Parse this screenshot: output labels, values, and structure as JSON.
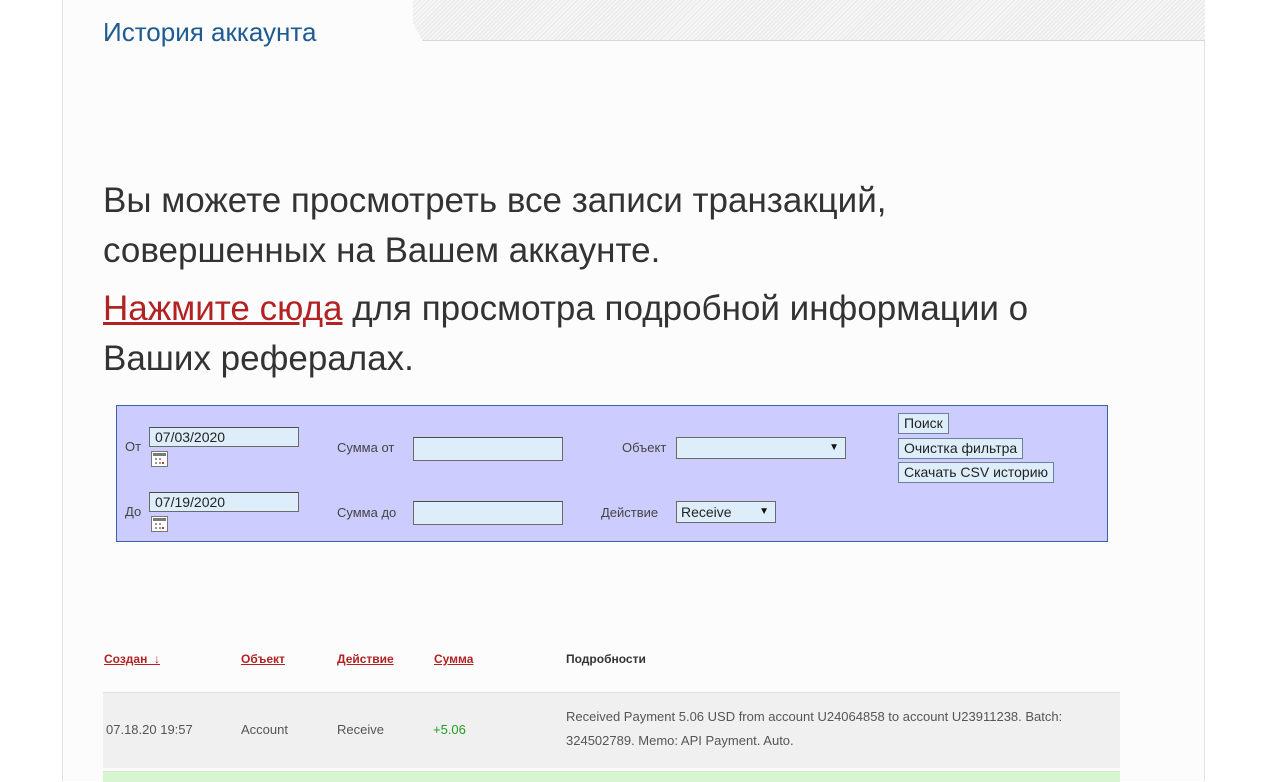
{
  "page": {
    "tab_title": "История аккаунта",
    "intro_text": "Вы можете просмотреть все записи транзакций, совершенных на Вашем аккаунте.",
    "referral_link_text": "Нажмите сюда",
    "referral_rest_text": " для просмотра подробной информации о Ваших рефералах."
  },
  "filter": {
    "from_label": "От",
    "from_value": "07/03/2020",
    "to_label": "До",
    "to_value": "07/19/2020",
    "amount_from_label": "Сумма от",
    "amount_from_value": "",
    "amount_to_label": "Сумма до",
    "amount_to_value": "",
    "object_label": "Объект",
    "object_value": "",
    "action_label": "Действие",
    "action_value": "Receive",
    "search_button": "Поиск",
    "clear_button": "Очистка фильтра",
    "csv_button": "Скачать CSV историю"
  },
  "table": {
    "headers": {
      "created": "Создан_↓",
      "object": "Объект",
      "action": "Действие",
      "amount": "Сумма",
      "details": "Подробности"
    },
    "rows": [
      {
        "created": "07.18.20 19:57",
        "object": "Account",
        "action": "Receive",
        "amount": "+5.06",
        "details": "Received Payment 5.06 USD from account U24064858 to account U23911238. Batch: 324502789. Memo: API Payment. Auto."
      }
    ]
  },
  "colors": {
    "link_red": "#b22222",
    "title_blue": "#1d5b92",
    "filter_bg": "#ccccff",
    "amount_green": "#1e9e1e"
  }
}
